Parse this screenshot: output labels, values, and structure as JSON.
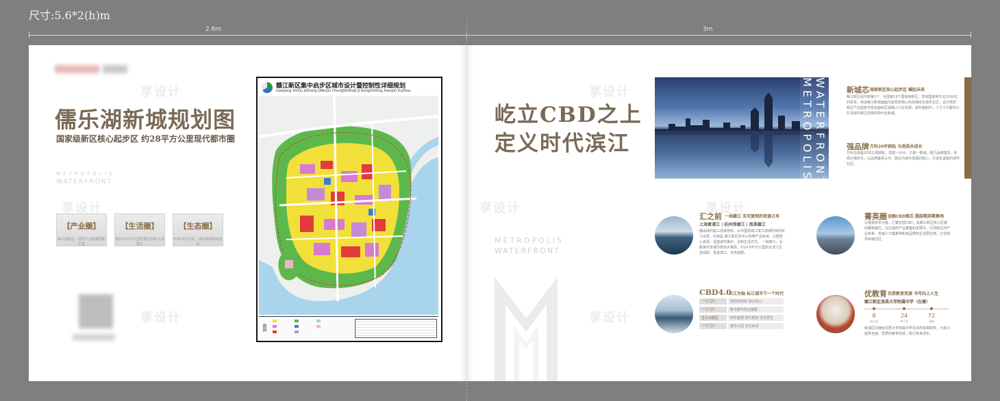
{
  "header": {
    "size_label": "尺寸:5.6*2(h)m",
    "ruler_left": "2.6m",
    "ruler_right": "3m"
  },
  "left_page": {
    "title": "儒乐湖新城规划图",
    "subtitle": "国家级新区核心起步区 约28平方公里现代都市圈",
    "metro_line1": "METROPOLIS",
    "metro_line2": "WATERFRONT",
    "tags": [
      {
        "title": "【产业圈】",
        "desc": "每片园新区、领导产业集聚群新区基"
      },
      {
        "title": "【生活圈】",
        "desc": "规划10平方公里的居住高新大城集区"
      },
      {
        "title": "【生态圈】",
        "desc": "开来10亿打造、规划将规融的建设"
      }
    ]
  },
  "map": {
    "title": "赣江新区集中启步区城市设计暨控制性详细规划",
    "pinyin": "GanJiang XinQu JiZhong QiBuQu ChengShiSheJi Ji KongZhiXing XiangXi GuiHua",
    "legend_label": "图例"
  },
  "right_page": {
    "headline_line1": "屹立CBD之上",
    "headline_line2": "定义时代滨江",
    "metro_line1": "METROPOLIS",
    "metro_line2": "WATERFRONT",
    "vertical_1": "METROPOLIS",
    "vertical_2": "WATERFRONT",
    "sections": {
      "xincheng": {
        "title": "新城芯",
        "sub": "国家新区核心起步区 崛起未来",
        "body": "赣江新区是中部第2个、全国第18个国家级新区，享有国家和华北1000亿的投资，缔造赣江新城面面均是规划核心的高端综合城市主区，设计规划 新区产业起航市投资面积区城镇人口主资源，提升面积约，十几十万都市以 打造城市新区前核的现代化新城。"
      },
      "qiangpin": {
        "title": "强品牌",
        "sub": "万科20年耕耘 与南昌共成长",
        "body": "万科在南昌20年扎根耕耘，筑建一片片，只建一楼城，践行品牌理念，体现价值所在，以品牌赢得认可，融合为城市发展的核心，打造有温度的城市社区。"
      },
      "huizhishe": {
        "title": "汇之前",
        "sub": "一线赣江 无可复制的资源占有",
        "line2": "上海黄浦江 | 杭州钱塘江 | 南昌赣江",
        "body": "都会级的临江前城地标，从中国前城江滨江滨城所有的实力出发，在南昌 赣江新区的中心地带产业新城，占据核心资源，遥望城市美好，全新生活方式。 一线赣江，近距离尽享城市规划大格局，约14.6平方公里的大滨江生态绿岸，享受滨江，无界视野。"
      },
      "jingying": {
        "title": "菁英圈",
        "sub": "金融CBD都芯 圈层精英聚集地",
        "body": "以金融资本为首，汇聚总部CBD，是赣江新区核心区域的精英都芯，在区域的产业聚集和发展中，引领新区的产业未来，高端人才集聚地和高品质的生活居住地，打造城市高端住区。"
      },
      "cbd": {
        "title": "CBD4.0",
        "sub": "以江为轴 标江城市下一个时代",
        "rows": [
          {
            "chip": "一个门户",
            "text": "规划双地标 滨江核心"
          },
          {
            "chip": "一个门户",
            "text": "繁华都市商业集群"
          },
          {
            "chip": "五大功能区",
            "text": "商务金融 现代服务 生态居住"
          },
          {
            "chip": "一个门户",
            "text": "城市公园 文化休闲"
          }
        ]
      },
      "youjiaoyu": {
        "title": "优教育",
        "sub": "优质教育资源 书写向上人生",
        "line2": "赣江新区南昌大学附属中学（在建）",
        "timeline": [
          {
            "num": "8",
            "label": "幼儿园"
          },
          {
            "num": "24",
            "label": "中小学"
          },
          {
            "num": "72",
            "label": "高校"
          }
        ],
        "body": "新城区内拥有优质大学附属中学及多所高等院校，为孩子提供全面、优质的教育资源，助力未来成长。"
      }
    }
  },
  "watermark": "享设计"
}
